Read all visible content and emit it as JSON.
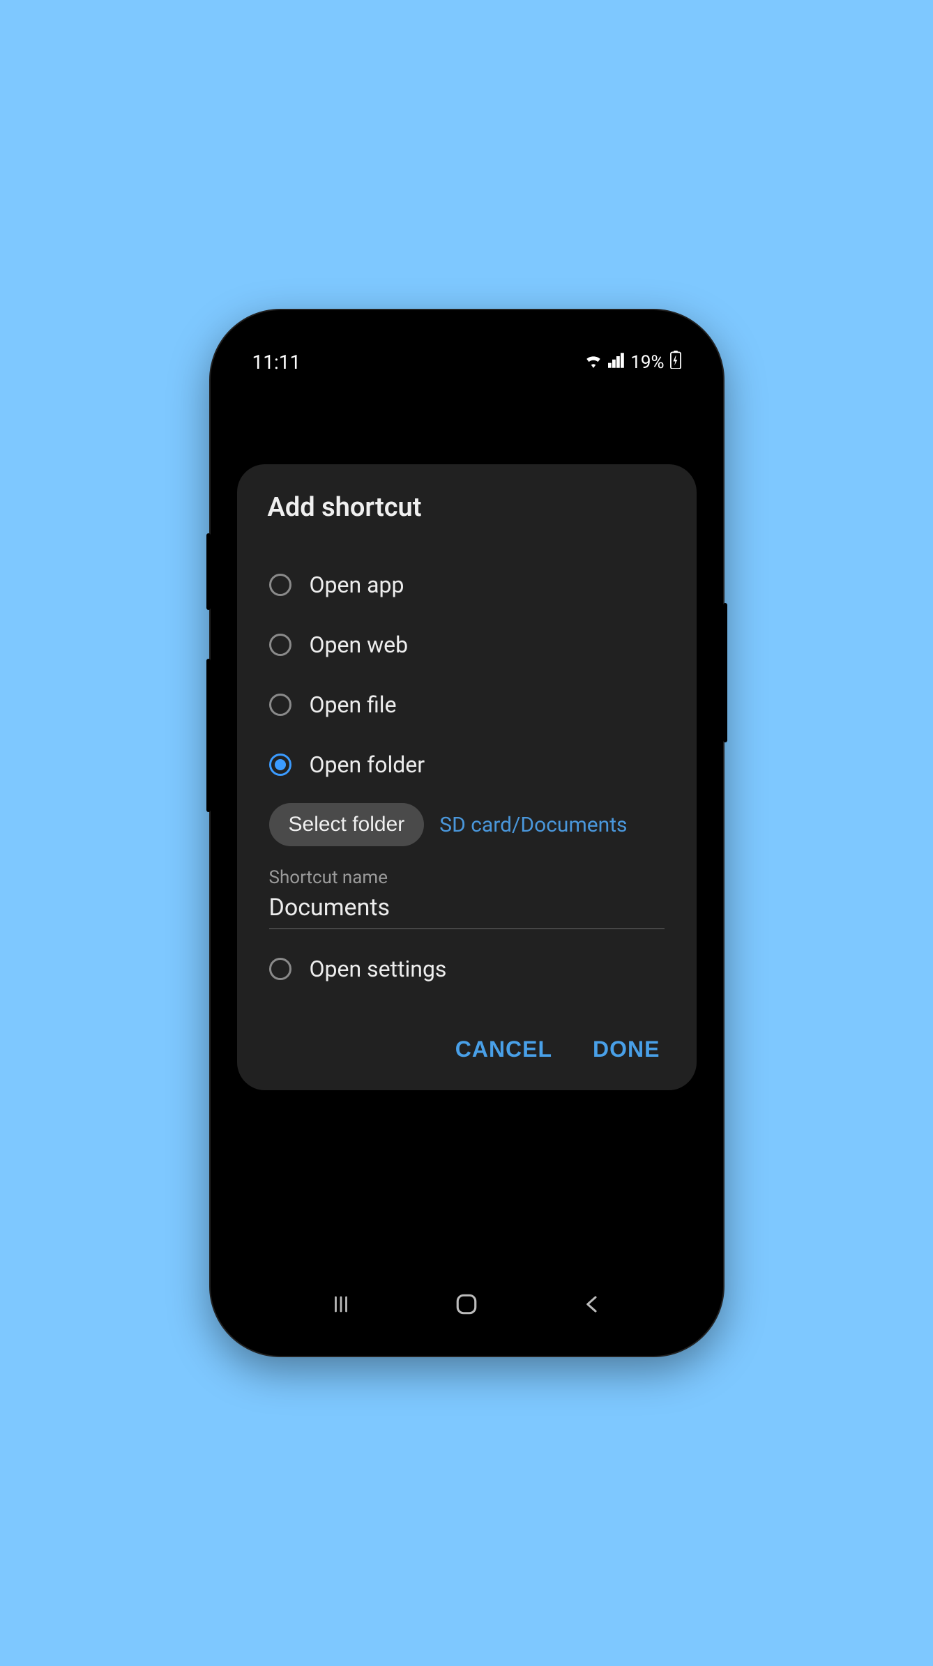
{
  "status": {
    "time": "11:11",
    "battery_text": "19%"
  },
  "dialog": {
    "title": "Add shortcut",
    "options": [
      {
        "label": "Open app",
        "selected": false
      },
      {
        "label": "Open web",
        "selected": false
      },
      {
        "label": "Open file",
        "selected": false
      },
      {
        "label": "Open folder",
        "selected": true
      },
      {
        "label": "Open settings",
        "selected": false
      }
    ],
    "select_folder_label": "Select folder",
    "selected_folder_path": "SD card/Documents",
    "shortcut_name_label": "Shortcut name",
    "shortcut_name_value": "Documents",
    "cancel_label": "CANCEL",
    "done_label": "DONE"
  },
  "colors": {
    "accent": "#3b9bff",
    "link": "#4a97db"
  }
}
